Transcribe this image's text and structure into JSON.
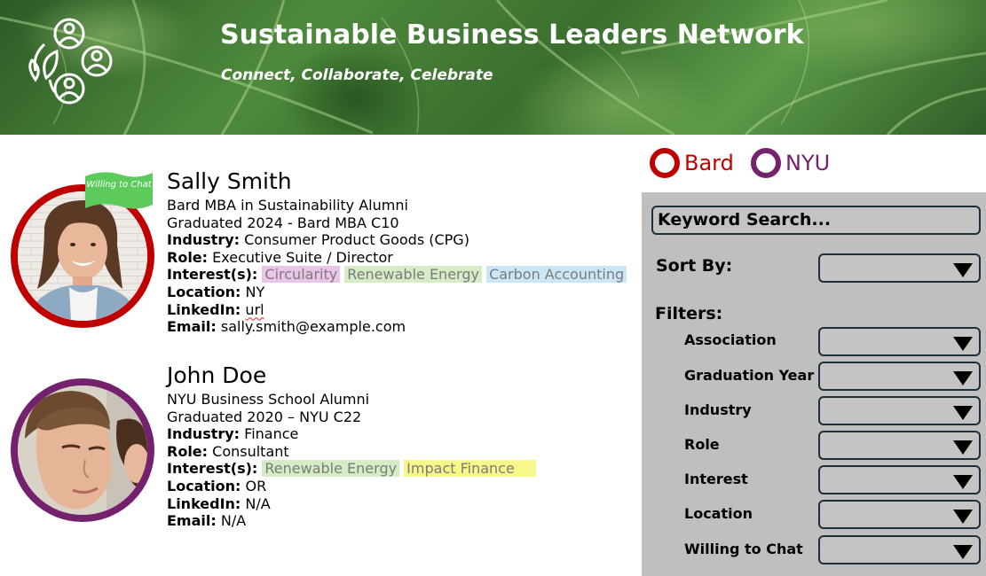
{
  "header": {
    "title": "Sustainable Business Leaders Network",
    "tagline": "Connect, Collaborate, Celebrate",
    "logo_icon": "people-network-leaf-icon"
  },
  "associations": [
    {
      "label": "Bard",
      "color": "#c00000"
    },
    {
      "label": "NYU",
      "color": "#74226e"
    }
  ],
  "profiles": [
    {
      "name": "Sally Smith",
      "program": "Bard MBA in Sustainability Alumni",
      "graduated": "Graduated 2024 - Bard MBA C10",
      "industry_label": "Industry:",
      "industry": "Consumer Product Goods (CPG)",
      "role_label": "Role:",
      "role": "Executive Suite / Director",
      "interests_label": "Interest(s):",
      "interests": [
        "Circularity",
        "Renewable Energy",
        "Carbon Accounting"
      ],
      "location_label": "Location:",
      "location": "NY",
      "linkedin_label": "LinkedIn:",
      "linkedin": "url",
      "email_label": "Email:",
      "email": "sally.smith@example.com",
      "ring_color": "#c00000",
      "badge": "Willing to Chat",
      "badge_color": "#5ccb5c"
    },
    {
      "name": "John Doe",
      "program": "NYU Business School Alumni",
      "graduated": "Graduated 2020 – NYU C22",
      "industry_label": "Industry:",
      "industry": "Finance",
      "role_label": "Role:",
      "role": "Consultant",
      "interests_label": "Interest(s):",
      "interests": [
        "Renewable Energy",
        "Impact Finance"
      ],
      "location_label": "Location:",
      "location": "OR",
      "linkedin_label": "LinkedIn:",
      "linkedin": "N/A",
      "email_label": "Email:",
      "email": "N/A",
      "ring_color": "#74226e"
    }
  ],
  "interest_colors": {
    "Circularity": "#ebc4ea",
    "Renewable Energy": "#d6ecc6",
    "Carbon Accounting": "#cbe7f7",
    "Impact Finance": "#f8f789"
  },
  "panel": {
    "search_placeholder": "Keyword Search...",
    "sort_label": "Sort By:",
    "filters_label": "Filters:",
    "filters": [
      {
        "label": "Association",
        "value": ""
      },
      {
        "label": "Graduation Year",
        "value": ""
      },
      {
        "label": "Industry",
        "value": ""
      },
      {
        "label": "Role",
        "value": ""
      },
      {
        "label": "Interest",
        "value": ""
      },
      {
        "label": "Location",
        "value": ""
      },
      {
        "label": "Willing to Chat",
        "value": ""
      }
    ]
  }
}
